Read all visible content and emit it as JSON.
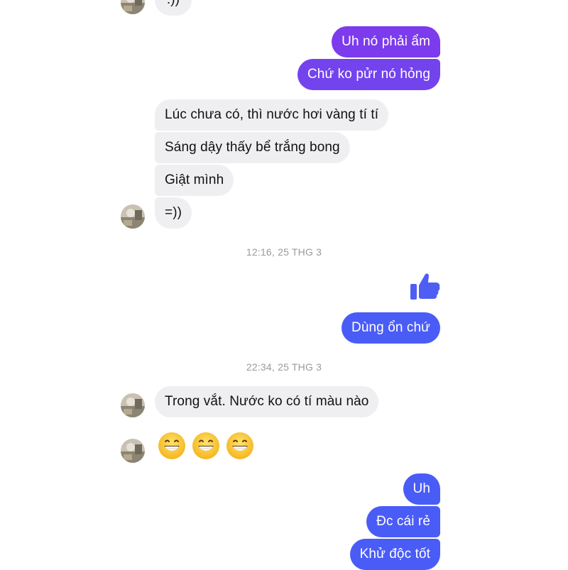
{
  "messages": {
    "in_top": ":))",
    "out_1": "Uh nó phải ẩm",
    "out_2": "Chứ ko pửr nó hỏng",
    "in_1": "Lúc chưa có, thì nước hơi vàng tí tí",
    "in_2": "Sáng dậy thấy bể trắng bong",
    "in_3": "Giật mình",
    "in_4": "=))",
    "out_3": "Dùng ổn chứ",
    "in_5": "Trong vắt. Nước ko có tí màu nào",
    "out_4": "Uh",
    "out_5": "Đc cái rẻ",
    "out_6": "Khử độc tốt"
  },
  "timestamps": {
    "t1": "12:16, 25 THG 3",
    "t2": "22:34, 25 THG 3"
  },
  "icons": {
    "avatar": "contact-avatar-icon",
    "like": "thumbs-up-icon",
    "emoji": "grinning-face-icon"
  },
  "colors": {
    "incoming_bubble": "#efeff1",
    "outgoing_purple": "#7c3bec",
    "outgoing_violet": "#6a4af2",
    "outgoing_blue": "#4a5cf6",
    "like": "#4f5ef2"
  }
}
